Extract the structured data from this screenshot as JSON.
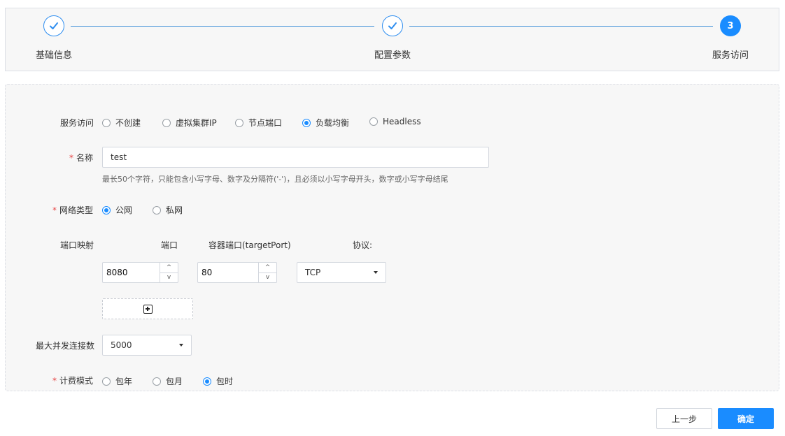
{
  "steps": [
    {
      "label": "基础信息",
      "state": "done",
      "icon": "check-icon"
    },
    {
      "label": "配置参数",
      "state": "done",
      "icon": "check-icon"
    },
    {
      "label": "服务访问",
      "state": "active",
      "number": "3"
    }
  ],
  "colors": {
    "accent": "#1a8cff",
    "required": "#e64545",
    "step_line": "#3d8fd8"
  },
  "form": {
    "service_access": {
      "label": "服务访问",
      "options": [
        "不创建",
        "虚拟集群IP",
        "节点端口",
        "负载均衡",
        "Headless"
      ],
      "selected": "负载均衡"
    },
    "name": {
      "label": "名称",
      "value": "test",
      "hint": "最长50个字符，只能包含小写字母、数字及分隔符('-')，且必须以小写字母开头，数字或小写字母结尾"
    },
    "network_type": {
      "label": "网络类型",
      "options": [
        "公网",
        "私网"
      ],
      "selected": "公网"
    },
    "port_mapping": {
      "label": "端口映射",
      "col_port": "端口",
      "col_target_port": "容器端口(targetPort)",
      "col_protocol": "协议:",
      "rows": [
        {
          "port": "8080",
          "target_port": "80",
          "protocol": "TCP"
        }
      ],
      "up_arrow": "^",
      "down_arrow": "v"
    },
    "max_connections": {
      "label": "最大并发连接数",
      "value": "5000"
    },
    "billing_mode": {
      "label": "计费模式",
      "options": [
        "包年",
        "包月",
        "包时"
      ],
      "selected": "包时"
    }
  },
  "footer": {
    "prev_label": "上一步",
    "confirm_label": "确定"
  },
  "required_mark": "*"
}
